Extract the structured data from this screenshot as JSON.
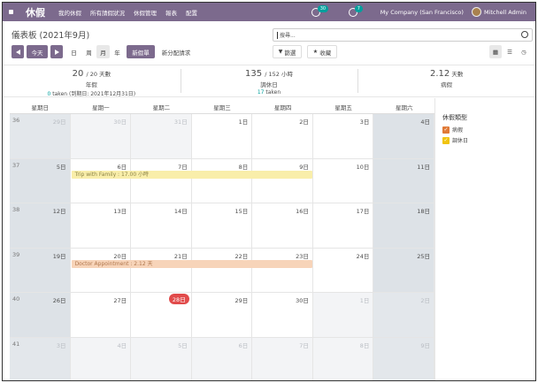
{
  "navbar": {
    "brand": "休假",
    "menu": [
      "我的休假",
      "所有請假狀況",
      "休假管理",
      "報表",
      "配置"
    ],
    "activity_count": "30",
    "message_count": "7",
    "company": "My Company (San Francisco)",
    "user": "Mitchell Admin",
    "color": "#7c6a8d"
  },
  "control": {
    "title": "儀表板 (2021年9月)",
    "today": "今天",
    "views": {
      "day": "日",
      "week": "周",
      "month": "月",
      "year": "年"
    },
    "new_leave": "新假單",
    "new_allocation": "新分配請求",
    "search_placeholder": "搜尋...",
    "filters": "篩選",
    "favorites": "收藏"
  },
  "summary": [
    {
      "value": "20",
      "total": "/ 20 天數",
      "label": "年假",
      "taken": "0",
      "taken_text": " taken (到期日: 2021年12月31日)"
    },
    {
      "value": "135",
      "total": "/ 152 小時",
      "label": "調休日",
      "taken": "17",
      "taken_text": " taken"
    },
    {
      "value": "2.12",
      "total": " 天數",
      "label": "病假",
      "taken": "",
      "taken_text": ""
    }
  ],
  "calendar": {
    "weekdays": [
      "星期日",
      "星期一",
      "星期二",
      "星期三",
      "星期四",
      "星期五",
      "星期六"
    ],
    "weeks": [
      {
        "num": "36",
        "days": [
          "29日",
          "30日",
          "31日",
          "1日",
          "2日",
          "3日",
          "4日"
        ],
        "other": [
          true,
          true,
          true,
          false,
          false,
          false,
          false
        ]
      },
      {
        "num": "37",
        "days": [
          "5日",
          "6日",
          "7日",
          "8日",
          "9日",
          "10日",
          "11日"
        ],
        "other": [
          false,
          false,
          false,
          false,
          false,
          false,
          false
        ]
      },
      {
        "num": "38",
        "days": [
          "12日",
          "13日",
          "14日",
          "15日",
          "16日",
          "17日",
          "18日"
        ],
        "other": [
          false,
          false,
          false,
          false,
          false,
          false,
          false
        ]
      },
      {
        "num": "39",
        "days": [
          "19日",
          "20日",
          "21日",
          "22日",
          "23日",
          "24日",
          "25日"
        ],
        "other": [
          false,
          false,
          false,
          false,
          false,
          false,
          false
        ]
      },
      {
        "num": "40",
        "days": [
          "26日",
          "27日",
          "28日",
          "29日",
          "30日",
          "1日",
          "2日"
        ],
        "other": [
          false,
          false,
          false,
          false,
          false,
          true,
          true
        ]
      },
      {
        "num": "41",
        "days": [
          "3日",
          "4日",
          "5日",
          "6日",
          "7日",
          "8日",
          "9日"
        ],
        "other": [
          true,
          true,
          true,
          true,
          true,
          true,
          true
        ]
      }
    ],
    "today": {
      "week": 4,
      "day": 2
    },
    "events": [
      {
        "label": "Trip with Family : 17.00 小時",
        "week": 1,
        "start": 1,
        "end": 4,
        "color": "yellow"
      },
      {
        "label": "Doctor Appointment : 2.12 天",
        "week": 3,
        "start": 1,
        "end": 4,
        "color": "orange"
      }
    ]
  },
  "sidebar": {
    "title": "休假類型",
    "types": [
      {
        "label": "病假",
        "color": "#e07a37"
      },
      {
        "label": "調休日",
        "color": "#f1c40f"
      }
    ]
  }
}
